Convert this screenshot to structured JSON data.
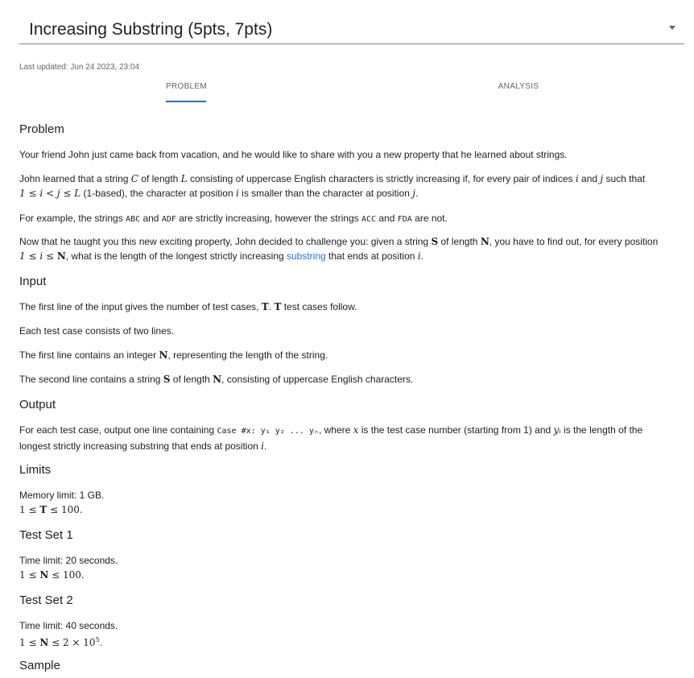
{
  "header": {
    "title": "Increasing Substring (5pts, 7pts)",
    "last_updated": "Last updated: Jun 24 2023, 23:04"
  },
  "tabs": {
    "problem": "PROBLEM",
    "analysis": "ANALYSIS"
  },
  "headings": {
    "problem": "Problem",
    "input": "Input",
    "output": "Output",
    "limits": "Limits",
    "test_set_1": "Test Set 1",
    "test_set_2": "Test Set 2",
    "sample": "Sample"
  },
  "problem": {
    "p1": "Your friend John just came back from vacation, and he would like to share with you a new property that he learned about strings.",
    "p2a": "John learned that a string ",
    "p2_C": "C",
    "p2b": " of length ",
    "p2_L": "L",
    "p2c": " consisting of uppercase English characters is strictly increasing if, for every pair of indices ",
    "p2_i": "i",
    "p2d": " and ",
    "p2_j": "j",
    "p2e": " such that",
    "p2_math": "1 ≤ i < j ≤ L",
    "p2f": " (1-based), the character at position ",
    "p2_i2": "i",
    "p2g": " is smaller than the character at position ",
    "p2_j2": "j",
    "p2h": ".",
    "p3a": "For example, the strings ",
    "p3_abc": "ABC",
    "p3b": " and ",
    "p3_adf": "ADF",
    "p3c": " are strictly increasing, however the strings ",
    "p3_acc": "ACC",
    "p3d": " and ",
    "p3_fda": "FDA",
    "p3e": " are not.",
    "p4a": "Now that he taught you this new exciting property, John decided to challenge you: given a string ",
    "p4_S": "S",
    "p4b": " of length ",
    "p4_N": "N",
    "p4c": ", you have to find out, for every position",
    "p4_math1": "1 ≤ i ≤ ",
    "p4_math_N": "N",
    "p4d": ", what is the length of the longest strictly increasing ",
    "p4_link": "substring",
    "p4e": " that ends at position ",
    "p4_i": "i",
    "p4f": "."
  },
  "input": {
    "l1a": "The first line of the input gives the number of test cases, ",
    "l1_T": "T",
    "l1b": ". ",
    "l1_T2": "T",
    "l1c": " test cases follow.",
    "l2": "Each test case consists of two lines.",
    "l3a": "The first line contains an integer ",
    "l3_N": "N",
    "l3b": ", representing the length of the string.",
    "l4a": "The second line contains a string ",
    "l4_S": "S",
    "l4b": " of length ",
    "l4_N": "N",
    "l4c": ", consisting of uppercase English characters."
  },
  "output": {
    "a": "For each test case, output one line containing ",
    "code": "Case #x: y₁ y₂ ... yₙ",
    "b": ", where ",
    "x": "x",
    "c": " is the test case number (starting from 1) and ",
    "yi": "yᵢ",
    "d": " is the length of the",
    "e": "longest strictly increasing substring that ends at position ",
    "i": "i",
    "f": "."
  },
  "limits": {
    "memory": "Memory limit: 1 GB.",
    "t_pre": "1 ≤ ",
    "t_T": "T",
    "t_post": " ≤ 100."
  },
  "test_set_1": {
    "time": "Time limit: 20 seconds.",
    "pre": "1 ≤ ",
    "N": "N",
    "post": " ≤ 100."
  },
  "test_set_2": {
    "time": "Time limit: 40 seconds.",
    "pre": "1 ≤ ",
    "N": "N",
    "post": " ≤ 2 × 10",
    "exp": "5",
    "end": "."
  }
}
